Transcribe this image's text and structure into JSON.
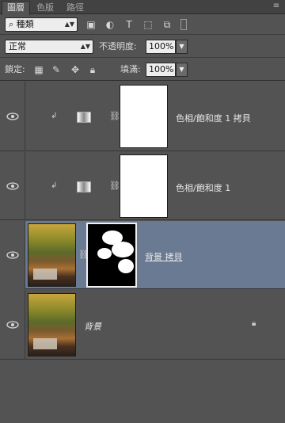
{
  "tabs": [
    {
      "label": "圖層"
    },
    {
      "label": "色版"
    },
    {
      "label": "路徑"
    }
  ],
  "filter": {
    "kind_label": "種類"
  },
  "blend": {
    "mode": "正常",
    "opacity_label": "不透明度:",
    "opacity_value": "100%"
  },
  "locks": {
    "label": "鎖定:",
    "fill_label": "填滿:",
    "fill_value": "100%"
  },
  "layers": [
    {
      "name": "色相/飽和度 1 拷貝"
    },
    {
      "name": "色相/飽和度 1"
    },
    {
      "name": "背景 拷貝"
    },
    {
      "name": "背景"
    }
  ]
}
